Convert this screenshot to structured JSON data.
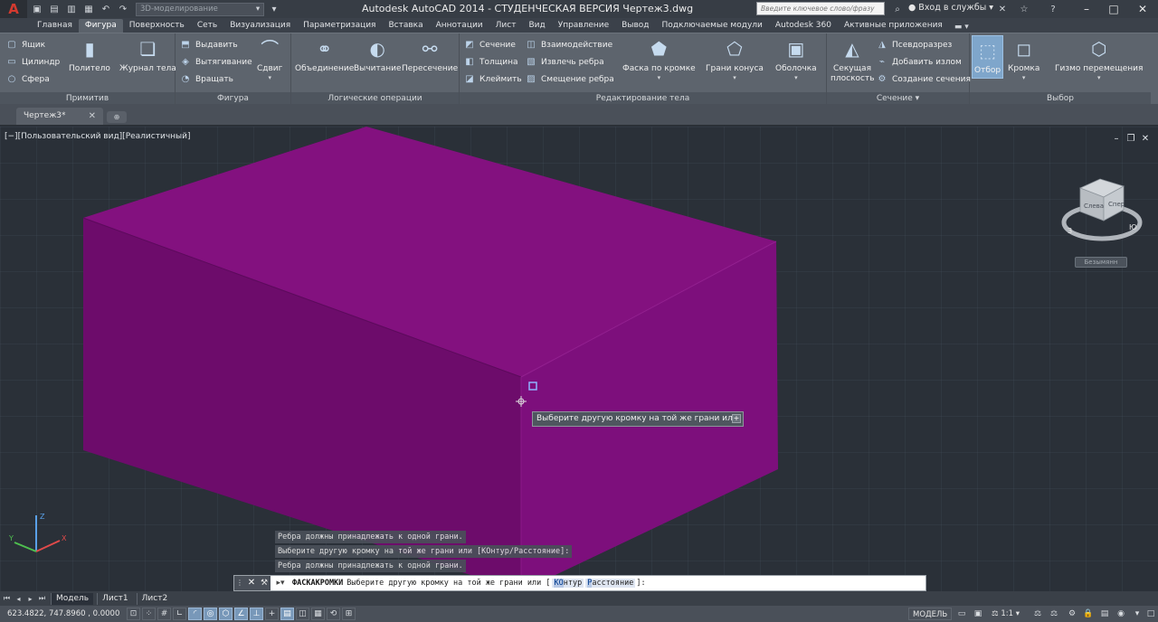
{
  "app": {
    "window_title": "Autodesk AutoCAD 2014 - СТУДЕНЧЕСКАЯ ВЕРСИЯ     Чертеж3.dwg",
    "workspace": "3D-моделирование",
    "search_placeholder": "Введите ключевое слово/фразу",
    "login_label": "Вход в службы"
  },
  "ribbon_tabs": [
    "Главная",
    "Фигура",
    "Поверхность",
    "Сеть",
    "Визуализация",
    "Параметризация",
    "Вставка",
    "Аннотации",
    "Лист",
    "Вид",
    "Управление",
    "Вывод",
    "Подключаемые модули",
    "Autodesk 360",
    "Активные приложения"
  ],
  "ribbon_active_tab": "Фигура",
  "panels": {
    "primitive": {
      "title": "Примитив",
      "box": "Ящик",
      "cylinder": "Цилиндр",
      "sphere": "Сфера",
      "polysolid": "Политело",
      "history": "Журнал тела"
    },
    "figure": {
      "title": "Фигура",
      "extrude": "Выдавить",
      "loft": "Вытягивание",
      "revolve": "Вращать",
      "sweep": "Сдвиг"
    },
    "boolean": {
      "title": "Логические операции",
      "union": "Объединение",
      "subtract": "Вычитание",
      "intersect": "Пересечение"
    },
    "solid_edit": {
      "title": "Редактирование тела",
      "section": "Сечение",
      "thicken": "Толщина",
      "imprint": "Клеймить",
      "interfere": "Взаимодействие",
      "extract_edges": "Извлечь ребра",
      "offset_edges": "Смещение ребра",
      "chamfer_edge": "Фаска по кромке",
      "taper_faces": "Грани конуса",
      "shell": "Оболочка"
    },
    "section": {
      "title": "Сечение",
      "section_plane": "Секущая плоскость",
      "live_section": "Псевдоразрез",
      "add_jog": "Добавить излом",
      "generate_section": "Создание сечения"
    },
    "selection": {
      "title": "Выбор",
      "culling": "Отбор",
      "edge": "Кромка",
      "gizmo": "Гизмо перемещения"
    }
  },
  "doc_tab": "Чертеж3*",
  "viewport_label": "[−][Пользовательский вид][Реалистичный]",
  "viewcube": {
    "left_face": "Слева",
    "front_face": "Спер",
    "compass_w": "З",
    "compass_s": "Ю",
    "wcs_label": "Безымянн"
  },
  "tooltip": "Выберите другую кромку на той же грани или",
  "command_history": [
    "Ребра должны принадлежать к одной грани.",
    "Выберите другую кромку на той же грани или [КОнтур/Расстояние]:",
    "Ребра должны принадлежать к одной грани."
  ],
  "command_line": {
    "name": "ФАСКАКРОМКИ",
    "prompt": "Выберите другую кромку на той же грани или [",
    "opt1_key": "КО",
    "opt1_rest": "нтур",
    "opt2_key": "Р",
    "opt2_rest": "асстояние",
    "end": "]:"
  },
  "layout_tabs": [
    "Модель",
    "Лист1",
    "Лист2"
  ],
  "status": {
    "coordinates": "623.4822, 747.8960 , 0.0000",
    "model_space": "МОДЕЛЬ",
    "annotation_scale": "1:1"
  },
  "colors": {
    "solid_box": "#7a0a78",
    "ribbon": "#5d646d",
    "drawing_background": "#2a3038",
    "active_tab": "#5b626b",
    "accent": "#7fa6cb"
  }
}
